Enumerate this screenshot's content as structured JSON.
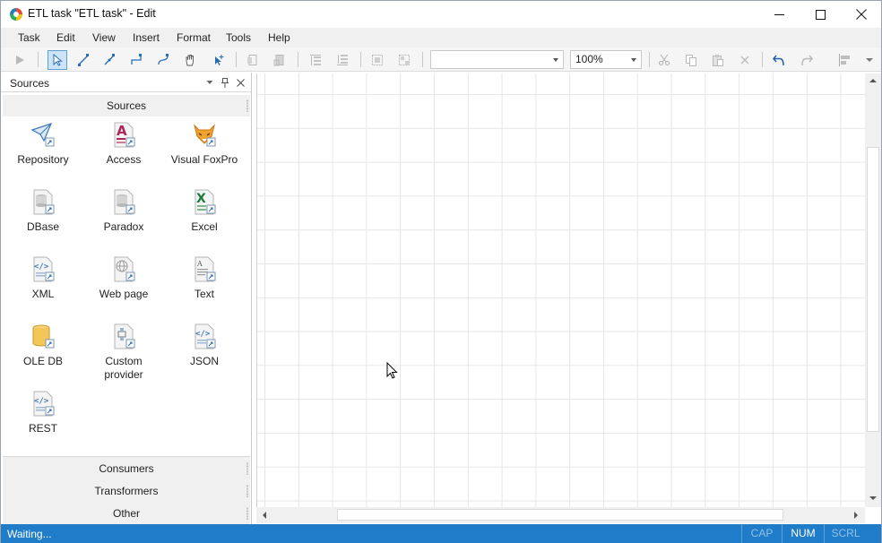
{
  "window": {
    "title": "ETL task \"ETL task\" - Edit",
    "controls": [
      "minimize",
      "maximize",
      "close"
    ]
  },
  "menu": {
    "items": [
      "Task",
      "Edit",
      "View",
      "Insert",
      "Format",
      "Tools",
      "Help"
    ]
  },
  "toolbar": {
    "style_combo_value": "",
    "zoom_value": "100%",
    "icons": [
      "run-icon",
      "pointer-icon",
      "line-icon",
      "diagonal-connector-icon",
      "orthogonal-connector-icon",
      "curved-connector-icon",
      "hand-icon",
      "add-point-icon",
      "bring-front-icon",
      "send-back-icon",
      "align-top-icon",
      "align-bottom-icon",
      "group-icon",
      "ungroup-icon",
      "cut-icon",
      "copy-icon",
      "paste-icon",
      "delete-icon",
      "undo-icon",
      "redo-icon",
      "align-icon",
      "more-icon"
    ]
  },
  "panel": {
    "title": "Sources",
    "group_header": "Sources",
    "tiles": [
      {
        "label": "Repository",
        "icon": "repository-icon"
      },
      {
        "label": "Access",
        "icon": "access-icon"
      },
      {
        "label": "Visual FoxPro",
        "icon": "foxpro-icon"
      },
      {
        "label": "DBase",
        "icon": "dbase-icon"
      },
      {
        "label": "Paradox",
        "icon": "paradox-icon"
      },
      {
        "label": "Excel",
        "icon": "excel-icon"
      },
      {
        "label": "XML",
        "icon": "xml-icon"
      },
      {
        "label": "Web page",
        "icon": "web-page-icon"
      },
      {
        "label": "Text",
        "icon": "text-icon"
      },
      {
        "label": "OLE DB",
        "icon": "oledb-icon"
      },
      {
        "label": "Custom provider",
        "icon": "custom-provider-icon"
      },
      {
        "label": "JSON",
        "icon": "json-icon"
      },
      {
        "label": "REST",
        "icon": "rest-icon"
      }
    ],
    "other_groups": [
      "Consumers",
      "Transformers",
      "Other"
    ]
  },
  "status": {
    "text": "Waiting...",
    "indicators": [
      {
        "label": "CAP",
        "active": false
      },
      {
        "label": "NUM",
        "active": true
      },
      {
        "label": "SCRL",
        "active": false
      }
    ]
  },
  "colors": {
    "statusbar": "#1e7cc8",
    "accent": "#1e7cc8",
    "grid": "#e6e6e6"
  }
}
